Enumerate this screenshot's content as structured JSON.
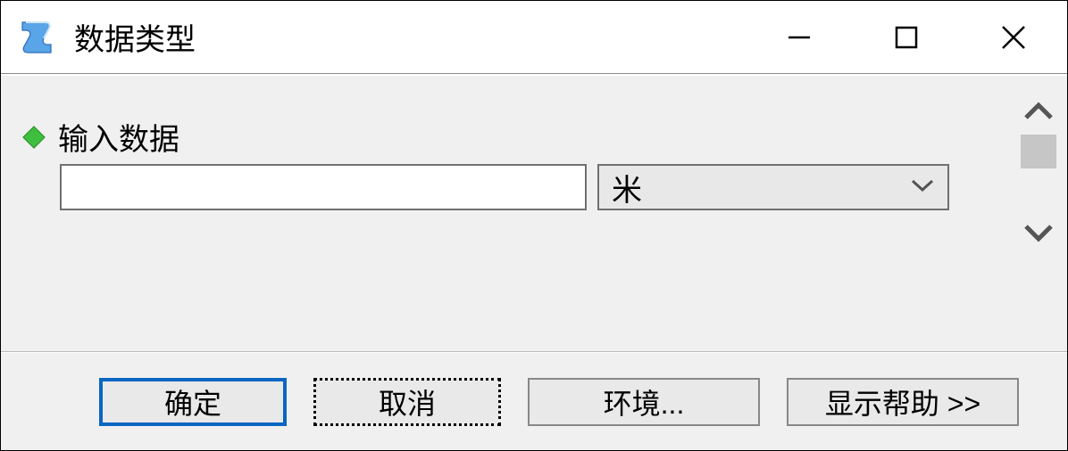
{
  "window": {
    "title": "数据类型"
  },
  "content": {
    "field_label": "输入数据",
    "input_value": "",
    "dropdown_value": "米"
  },
  "buttons": {
    "ok": "确定",
    "cancel": "取消",
    "env": "环境...",
    "help": "显示帮助 >>"
  }
}
